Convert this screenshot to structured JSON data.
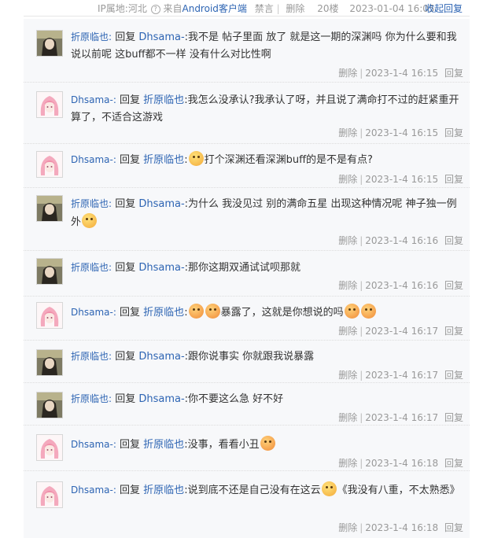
{
  "topbar": {
    "ip_location": "IP属地:河北",
    "source_prefix": "来自",
    "source_client": "Android客户端",
    "ban": "禁言",
    "delete": "删除",
    "floor": "20楼",
    "datetime": "2023-01-04 16:05",
    "collapse": "收起回复"
  },
  "replies": [
    {
      "user": "折原临也:",
      "reply_word": "回复",
      "target": "Dhsama-",
      "text": ":我不是 帖子里面 放了 就是这一期的深渊吗 你为什么要和我说以前呢 这buff都不一样 没有什么对比性啊",
      "delete": "删除",
      "time": "2023-1-4 16:15",
      "reply": "回复",
      "avatar": "dark-hair-avatar"
    },
    {
      "user": "Dhsama-:",
      "reply_word": "回复",
      "target": "折原临也",
      "text": ":我怎么没承认?我承认了呀，并且说了满命打不过的赶紧重开算了，不适合这游戏",
      "delete": "删除",
      "time": "2023-1-4 16:15",
      "reply": "回复",
      "avatar": "pink-hair-avatar"
    },
    {
      "user": "Dhsama-:",
      "reply_word": "回复",
      "target": "折原临也",
      "text_pre": ":",
      "text": "打个深渊还看深渊buff的是不是有点?",
      "delete": "删除",
      "time": "2023-1-4 16:15",
      "reply": "回复",
      "avatar": "pink-hair-avatar"
    },
    {
      "user": "折原临也:",
      "reply_word": "回复",
      "target": "Dhsama-",
      "text": ":为什么 我没见过 别的满命五星 出现这种情况呢 神子独一例外",
      "delete": "删除",
      "time": "2023-1-4 16:16",
      "reply": "回复",
      "avatar": "dark-hair-avatar"
    },
    {
      "user": "折原临也:",
      "reply_word": "回复",
      "target": "Dhsama-",
      "text": ":那你这期双通试试呗那就",
      "delete": "删除",
      "time": "2023-1-4 16:16",
      "reply": "回复",
      "avatar": "dark-hair-avatar"
    },
    {
      "user": "Dhsama-:",
      "reply_word": "回复",
      "target": "折原临也",
      "text_pre": ":",
      "text": "暴露了，这就是你想说的吗",
      "delete": "删除",
      "time": "2023-1-4 16:17",
      "reply": "回复",
      "avatar": "pink-hair-avatar"
    },
    {
      "user": "折原临也:",
      "reply_word": "回复",
      "target": "Dhsama-",
      "text": ":跟你说事实 你就跟我说暴露",
      "delete": "删除",
      "time": "2023-1-4 16:17",
      "reply": "回复",
      "avatar": "dark-hair-avatar"
    },
    {
      "user": "折原临也:",
      "reply_word": "回复",
      "target": "Dhsama-",
      "text": ":你不要这么急 好不好",
      "delete": "删除",
      "time": "2023-1-4 16:17",
      "reply": "回复",
      "avatar": "dark-hair-avatar"
    },
    {
      "user": "Dhsama-:",
      "reply_word": "回复",
      "target": "折原临也",
      "text": ":没事，看看小丑",
      "delete": "删除",
      "time": "2023-1-4 16:18",
      "reply": "回复",
      "avatar": "pink-hair-avatar"
    },
    {
      "user": "Dhsama-:",
      "reply_word": "回复",
      "target": "折原临也",
      "text": ":说到底不还是自己没有在这云",
      "text_post": "《我没有八重，不太熟悉》",
      "delete": "删除",
      "time": "2023-1-4 16:18",
      "reply": "回复",
      "avatar": "pink-hair-avatar"
    }
  ]
}
